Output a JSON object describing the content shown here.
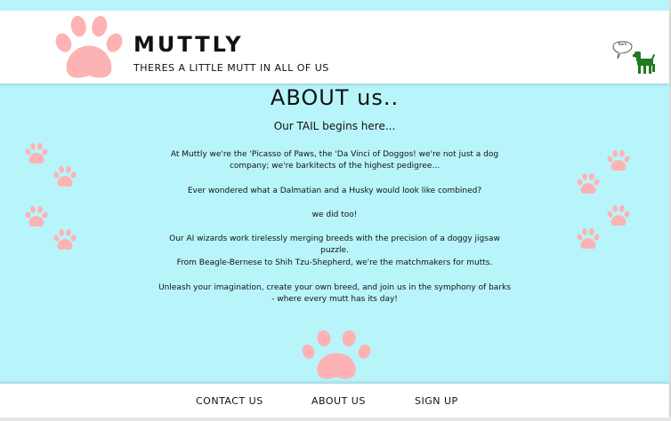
{
  "header": {
    "title": "MUTTLY",
    "tagline": "THERES A LITTLE MUTT IN ALL OF US",
    "mascot_bubble": "Bark ..."
  },
  "main": {
    "heading": "ABOUT us..",
    "subheading": "Our TAIL begins here...",
    "paragraphs": [
      "At Muttly we're the 'Picasso of Paws, the 'Da Vinci of Doggos! we're not just a dog company; we're barkitects of the highest pedigree...",
      "Ever wondered what a Dalmatian and a Husky would look like combined?",
      "we did too!",
      "Our AI wizards work tirelessly merging breeds with the precision of a doggy jigsaw puzzle.",
      "From Beagle-Bernese to Shih Tzu-Shepherd, we're the matchmakers for mutts.",
      "Unleash your imagination, create your own breed, and join us in the symphony of barks - where every mutt has its day!"
    ]
  },
  "footer": {
    "links": [
      "CONTACT US",
      "ABOUT US",
      "SIGN UP"
    ]
  },
  "colors": {
    "background": "#b8f5fb",
    "paw": "#fdb3b3",
    "dog": "#1f7a1f",
    "bar": "#ffffff"
  },
  "icons": [
    "paw-icon",
    "dog-icon",
    "speech-bubble-icon"
  ]
}
